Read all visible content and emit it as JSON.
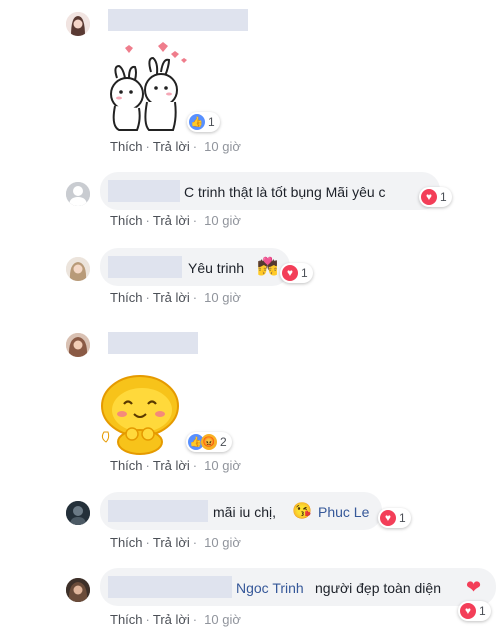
{
  "colors": {
    "link": "#365899",
    "meta": "#90949c",
    "bubble": "#f2f3f5",
    "love": "#f33e58",
    "like": "#5890ff",
    "angry": "#f7b125"
  },
  "comments": [
    {
      "text": "",
      "sticker": "rabbit-hug-sticker",
      "reaction_count": "1",
      "reaction": "like",
      "actions": {
        "like": "Thích",
        "reply": "Trả lời",
        "time": "10 giờ"
      }
    },
    {
      "text": "C trinh thật là tốt bụng Mãi yêu c",
      "reaction_count": "1",
      "reaction": "love",
      "actions": {
        "like": "Thích",
        "reply": "Trả lời",
        "time": "10 giờ"
      }
    },
    {
      "text": "Yêu trinh",
      "emoji": "couple-kiss-emoji",
      "reaction_count": "1",
      "reaction": "love",
      "actions": {
        "like": "Thích",
        "reply": "Trả lời",
        "time": "10 giờ"
      }
    },
    {
      "text": "",
      "sticker": "yellow-blob-sticker",
      "reaction_count": "2",
      "reaction": "like-angry",
      "actions": {
        "like": "Thích",
        "reply": "Trả lời",
        "time": "10 giờ"
      }
    },
    {
      "text": "mãi iu chị,",
      "emoji": "kiss-face-emoji",
      "mention": "Phuc Le",
      "reaction_count": "1",
      "reaction": "love",
      "actions": {
        "like": "Thích",
        "reply": "Trả lời",
        "time": "10 giờ"
      }
    },
    {
      "mention": "Ngoc Trinh",
      "text": "người đẹp toàn diện",
      "emoji": "heart-emoji",
      "reaction_count": "1",
      "reaction": "love",
      "actions": {
        "like": "Thích",
        "reply": "Trả lời",
        "time": "10 giờ"
      }
    }
  ]
}
